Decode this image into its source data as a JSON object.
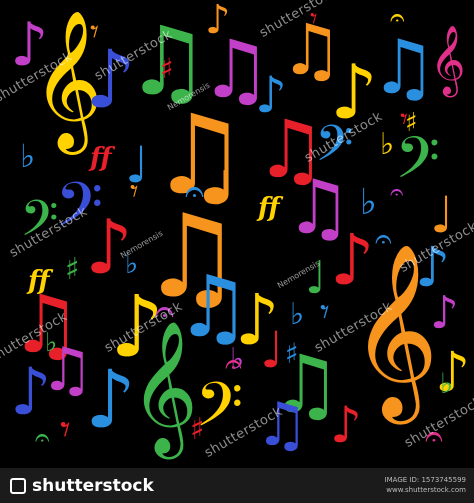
{
  "watermark_text": "shutterstock",
  "credit_text": "Nemorensis",
  "footer": {
    "brand": "shutterstock",
    "image_id": "IMAGE ID: 1573745599",
    "site": "www.shutterstock.com"
  },
  "palette": {
    "red": "#e8202a",
    "orange": "#f7941d",
    "yellow": "#ffd200",
    "green": "#3cb44b",
    "blue": "#2b8fe0",
    "indigo": "#3a4fd8",
    "violet": "#c23fc8",
    "magenta": "#e0308a",
    "background": "#000000"
  },
  "symbols": [
    {
      "icon": "treble-clef-icon",
      "glyph": "𝄞"
    },
    {
      "icon": "bass-clef-icon",
      "glyph": "𝄢"
    },
    {
      "icon": "eighth-note-icon",
      "glyph": "♪"
    },
    {
      "icon": "beamed-notes-icon",
      "glyph": "♫"
    },
    {
      "icon": "quarter-note-icon",
      "glyph": "♩"
    },
    {
      "icon": "sharp-icon",
      "glyph": "♯"
    },
    {
      "icon": "flat-icon",
      "glyph": "♭"
    },
    {
      "icon": "fermata-icon",
      "glyph": "𝄐"
    },
    {
      "icon": "rest-icon",
      "glyph": "𝄾"
    }
  ],
  "dynamics_text": "ff"
}
